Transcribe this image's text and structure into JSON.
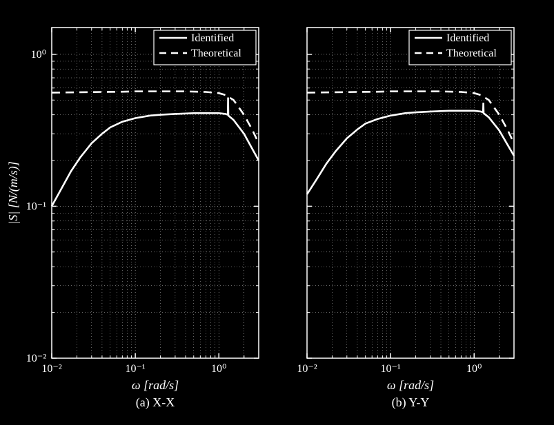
{
  "chart_data": [
    {
      "type": "line",
      "title": "(a) X-X",
      "xlabel": "ω [rad/s]",
      "ylabel": "|S| [N/(m/s)]",
      "xscale": "log",
      "yscale": "log",
      "xlim": [
        0.01,
        3.0
      ],
      "ylim": [
        0.01,
        1.5
      ],
      "xticks": [
        0.01,
        0.1,
        1.0
      ],
      "yticks": [
        0.01,
        0.1,
        1.0
      ],
      "grid": true,
      "legend": {
        "position": "top-right",
        "entries": [
          "Identified",
          "Theoretical"
        ]
      },
      "series": [
        {
          "name": "Identified",
          "style": "solid",
          "x": [
            0.01,
            0.013,
            0.017,
            0.022,
            0.03,
            0.04,
            0.05,
            0.07,
            0.1,
            0.15,
            0.2,
            0.3,
            0.5,
            0.7,
            1.0,
            1.2,
            1.28,
            1.29,
            1.3,
            1.5,
            2.0,
            2.5,
            3.0
          ],
          "y": [
            0.1,
            0.13,
            0.17,
            0.21,
            0.26,
            0.3,
            0.33,
            0.36,
            0.38,
            0.395,
            0.4,
            0.405,
            0.41,
            0.41,
            0.41,
            0.405,
            0.4,
            0.52,
            0.395,
            0.37,
            0.3,
            0.24,
            0.2
          ]
        },
        {
          "name": "Theoretical",
          "style": "dashed",
          "x": [
            0.01,
            0.02,
            0.04,
            0.07,
            0.1,
            0.2,
            0.4,
            0.7,
            1.0,
            1.2,
            1.5,
            2.0,
            2.5,
            3.0
          ],
          "y": [
            0.56,
            0.562,
            0.565,
            0.567,
            0.57,
            0.57,
            0.57,
            0.565,
            0.555,
            0.54,
            0.5,
            0.4,
            0.32,
            0.26
          ]
        }
      ]
    },
    {
      "type": "line",
      "title": "(b) Y-Y",
      "xlabel": "ω [rad/s]",
      "ylabel": "",
      "xscale": "log",
      "yscale": "log",
      "xlim": [
        0.01,
        3.0
      ],
      "ylim": [
        0.01,
        1.5
      ],
      "xticks": [
        0.01,
        0.1,
        1.0
      ],
      "yticks": [
        0.01,
        0.1,
        1.0
      ],
      "grid": true,
      "legend": {
        "position": "top-right",
        "entries": [
          "Identified",
          "Theoretical"
        ]
      },
      "series": [
        {
          "name": "Identified",
          "style": "solid",
          "x": [
            0.01,
            0.013,
            0.017,
            0.022,
            0.03,
            0.04,
            0.05,
            0.07,
            0.1,
            0.15,
            0.2,
            0.3,
            0.5,
            0.7,
            1.0,
            1.2,
            1.28,
            1.29,
            1.3,
            1.5,
            2.0,
            2.5,
            3.0
          ],
          "y": [
            0.12,
            0.15,
            0.19,
            0.23,
            0.28,
            0.32,
            0.35,
            0.375,
            0.395,
            0.41,
            0.415,
            0.42,
            0.425,
            0.425,
            0.425,
            0.42,
            0.415,
            0.48,
            0.41,
            0.385,
            0.315,
            0.255,
            0.215
          ]
        },
        {
          "name": "Theoretical",
          "style": "dashed",
          "x": [
            0.01,
            0.02,
            0.04,
            0.07,
            0.1,
            0.2,
            0.4,
            0.7,
            1.0,
            1.2,
            1.5,
            2.0,
            2.5,
            3.0
          ],
          "y": [
            0.56,
            0.562,
            0.565,
            0.567,
            0.57,
            0.57,
            0.57,
            0.565,
            0.555,
            0.54,
            0.5,
            0.4,
            0.32,
            0.26
          ]
        }
      ]
    }
  ],
  "tick_labels": {
    "x": [
      "10⁻²",
      "10⁻¹",
      "10⁰"
    ],
    "y": [
      "10⁻²",
      "10⁻¹",
      "10⁰"
    ]
  }
}
